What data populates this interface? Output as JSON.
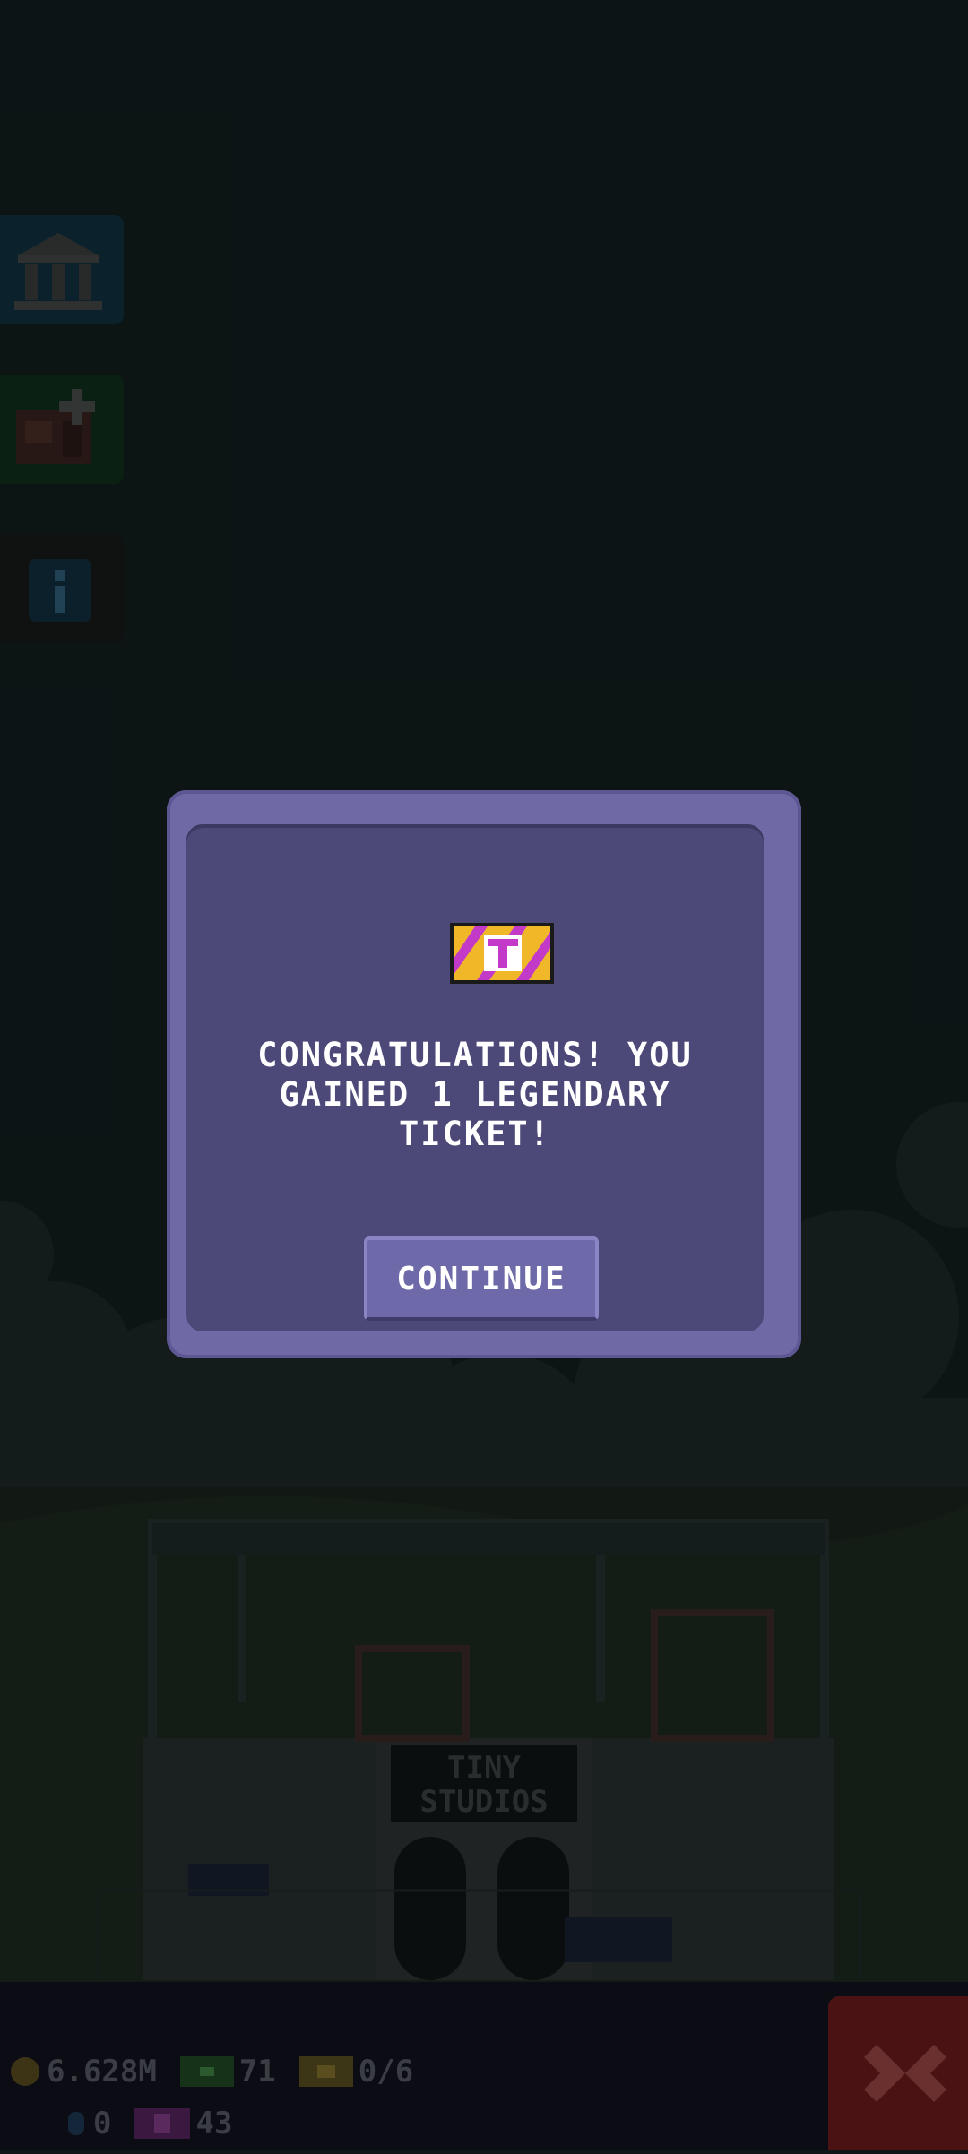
{
  "dialog": {
    "message": "CONGRATULATIONS! YOU GAINED 1 LEGENDARY TICKET!",
    "continue_label": "CONTINUE",
    "ticket_letter": "T"
  },
  "building": {
    "sign_line1": "TINY",
    "sign_line2": "STUDIOS"
  },
  "hud": {
    "coins": "6.628M",
    "bux": "71",
    "tickets_progress": "0/6",
    "gems": "0",
    "legendary_tickets": "43"
  },
  "icons": {
    "sidebar": [
      "bank-icon",
      "build-floor-icon",
      "info-icon"
    ],
    "close": "close-icon"
  },
  "colors": {
    "modal_outer": "#6f69a6",
    "modal_inner": "#4c4878",
    "button": "#6e69a8",
    "background": "#0f1718"
  }
}
